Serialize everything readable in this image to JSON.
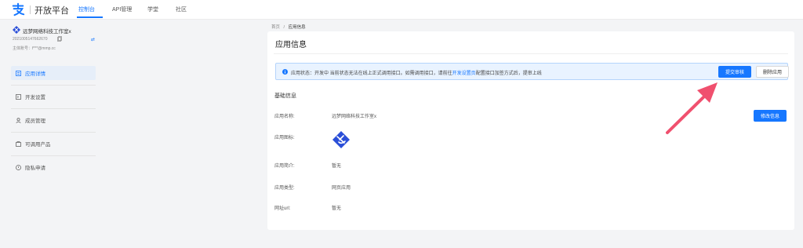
{
  "topbar": {
    "brand": "开放平台",
    "nav": [
      {
        "label": "控制台",
        "active": true
      },
      {
        "label": "API管理",
        "active": false
      },
      {
        "label": "学堂",
        "active": false
      },
      {
        "label": "社区",
        "active": false
      }
    ]
  },
  "sidebar": {
    "app_name": "远梦网络科技工作室x",
    "app_id": "2021005147662670",
    "owner": "主体账号：f***@mmp.cc",
    "menu": [
      {
        "label": "应用详情",
        "icon": "app-detail-icon",
        "active": true
      },
      {
        "label": "开发设置",
        "icon": "dev-settings-icon",
        "active": false
      },
      {
        "label": "成员管理",
        "icon": "members-icon",
        "active": false
      },
      {
        "label": "可调用产品",
        "icon": "products-icon",
        "active": false
      },
      {
        "label": "隐私申请",
        "icon": "privacy-icon",
        "active": false
      }
    ]
  },
  "breadcrumb": {
    "home": "首页",
    "sep": "/",
    "current": "应用信息"
  },
  "main": {
    "title": "应用信息",
    "notice": {
      "prefix": "应用状态：开发中 当前状态无法在线上正式调用接口。如需调用接口，请前往",
      "link": "开发设置页",
      "suffix": "配置接口加签方式后，提审上线",
      "submit_label": "提交审核",
      "delete_label": "删除应用"
    },
    "section_title": "基础信息",
    "fields": [
      {
        "label": "应用名称:",
        "value": "远梦网络科技工作室x"
      },
      {
        "label": "应用图标:",
        "value": ""
      },
      {
        "label": "应用简介:",
        "value": "暂无"
      },
      {
        "label": "应用类型:",
        "value": "网页应用"
      },
      {
        "label": "网址url:",
        "value": "暂无"
      }
    ],
    "modify_label": "修改信息"
  },
  "colors": {
    "accent": "#1677ff",
    "annotation_arrow": "#f0506e"
  }
}
